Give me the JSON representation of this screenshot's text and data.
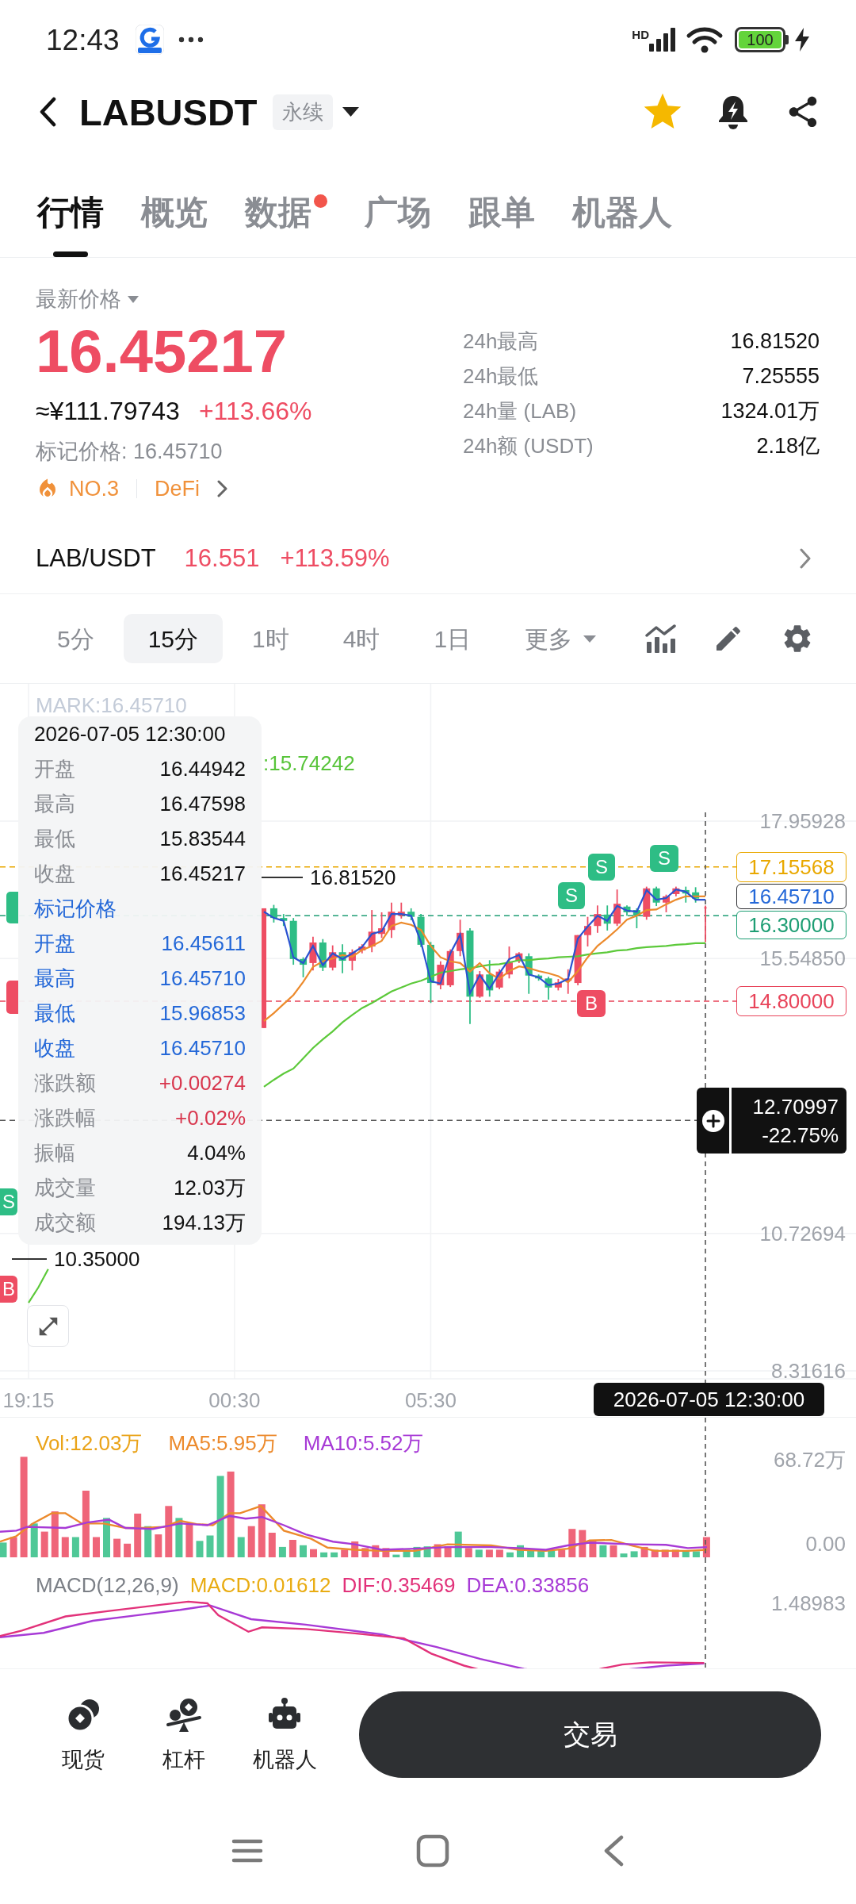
{
  "status_bar": {
    "time": "12:43",
    "network": "HD",
    "battery": "100",
    "charging": true
  },
  "header": {
    "symbol": "LABUSDT",
    "badge": "永续",
    "favorite": true
  },
  "tabs": [
    {
      "label": "行情",
      "selected": true,
      "dot": false
    },
    {
      "label": "概览",
      "selected": false,
      "dot": false
    },
    {
      "label": "数据",
      "selected": false,
      "dot": true
    },
    {
      "label": "广场",
      "selected": false,
      "dot": false
    },
    {
      "label": "跟单",
      "selected": false,
      "dot": false
    },
    {
      "label": "机器人",
      "selected": false,
      "dot": false
    }
  ],
  "price": {
    "label": "最新价格",
    "last": "16.45217",
    "cny": "≈¥111.79743",
    "change": "+113.66%",
    "mark": "标记价格: 16.45710",
    "rank": "NO.3",
    "sector": "DeFi"
  },
  "stats": [
    {
      "label": "24h最高",
      "value": "16.81520"
    },
    {
      "label": "24h最低",
      "value": "7.25555"
    },
    {
      "label": "24h量 (LAB)",
      "value": "1324.01万"
    },
    {
      "label": "24h额 (USDT)",
      "value": "2.18亿"
    }
  ],
  "spot_pair": {
    "pair": "LAB/USDT",
    "price": "16.551",
    "change": "+113.59%"
  },
  "intervals": [
    {
      "label": "5分",
      "kind": "option",
      "selected": false
    },
    {
      "label": "15分",
      "kind": "option",
      "selected": true
    },
    {
      "label": "1时",
      "kind": "option",
      "selected": false
    },
    {
      "label": "4时",
      "kind": "option",
      "selected": false
    },
    {
      "label": "1日",
      "kind": "option",
      "selected": false
    },
    {
      "label": "更多",
      "kind": "menu",
      "selected": false
    }
  ],
  "chart": {
    "mark_legend": "MARK:16.45710",
    "ma_legend": ":15.74242",
    "mark_price_tag": {
      "label": "16.45710",
      "color": "#2468d8"
    },
    "crosshair": {
      "change": "-22.75%",
      "price": "12.70997",
      "time": "2026-07-05 12:30:00"
    },
    "markers": [
      {
        "kind": "sell",
        "label": "S"
      },
      {
        "kind": "buy",
        "label": "B"
      },
      {
        "kind": "sell",
        "label": "S"
      },
      {
        "kind": "sell",
        "label": "S"
      },
      {
        "kind": "sell",
        "label": "S"
      },
      {
        "kind": "buy",
        "label": "B"
      }
    ],
    "chart_data": {
      "type": "candlestick",
      "grid": true,
      "ylim": [
        8.177,
        20.367
      ],
      "yticks": [
        {
          "value": 17.95928,
          "label": "17.95928"
        },
        {
          "value": 15.5485,
          "label": "15.54850"
        },
        {
          "value": 10.72694,
          "label": "10.72694"
        },
        {
          "value": 8.31616,
          "label": "8.31616"
        }
      ],
      "categories": [
        "19:15",
        null,
        null,
        null,
        null,
        null,
        null,
        null,
        null,
        null,
        null,
        null,
        null,
        null,
        null,
        null,
        null,
        null,
        null,
        null,
        null,
        "00:30",
        null,
        null,
        null,
        null,
        null,
        null,
        null,
        null,
        null,
        null,
        null,
        null,
        null,
        null,
        null,
        null,
        null,
        null,
        null,
        "05:30",
        null,
        null,
        null,
        null,
        null,
        null,
        null,
        null,
        null,
        null,
        null,
        null,
        null,
        null,
        null,
        null,
        null,
        null,
        null,
        null,
        null,
        null,
        null,
        null,
        null,
        null,
        null,
        null
      ],
      "ohlc": [
        null,
        null,
        null,
        null,
        null,
        null,
        null,
        null,
        null,
        null,
        null,
        null,
        null,
        null,
        null,
        null,
        null,
        null,
        null,
        null,
        null,
        null,
        null,
        null,
        [
          14.33,
          16.43,
          14.33,
          16.43
        ],
        [
          16.43,
          16.49,
          16.18,
          16.26
        ],
        [
          16.26,
          16.33,
          16.12,
          16.21
        ],
        [
          16.21,
          16.26,
          15.44,
          15.54
        ],
        [
          15.54,
          15.57,
          15.22,
          15.44
        ],
        [
          15.47,
          15.93,
          15.34,
          15.83
        ],
        [
          15.83,
          15.89,
          15.33,
          15.39
        ],
        [
          15.39,
          15.78,
          15.34,
          15.66
        ],
        [
          15.66,
          15.8,
          15.29,
          15.51
        ],
        [
          15.51,
          15.71,
          15.34,
          15.66
        ],
        [
          15.69,
          15.8,
          15.64,
          15.76
        ],
        [
          15.76,
          16.4,
          15.66,
          16.02
        ],
        [
          15.98,
          16.36,
          15.91,
          16.08
        ],
        [
          16.05,
          16.53,
          15.91,
          16.37
        ],
        [
          16.3,
          16.53,
          16.25,
          16.37
        ],
        [
          16.37,
          16.43,
          16.22,
          16.28
        ],
        [
          16.28,
          16.33,
          15.75,
          15.79
        ],
        [
          15.79,
          15.84,
          14.77,
          15.12
        ],
        [
          15.08,
          15.5,
          15.01,
          15.44
        ],
        [
          15.08,
          15.71,
          15.05,
          15.68
        ],
        [
          15.68,
          16.23,
          15.59,
          16.0
        ],
        [
          16.04,
          16.08,
          14.4,
          14.88
        ],
        [
          14.88,
          15.33,
          14.86,
          15.27
        ],
        [
          15.27,
          15.52,
          14.88,
          14.99
        ],
        [
          15.04,
          15.36,
          15.01,
          15.32
        ],
        [
          15.27,
          15.76,
          15.2,
          15.48
        ],
        [
          15.5,
          15.66,
          15.47,
          15.64
        ],
        [
          15.59,
          15.64,
          14.93,
          15.25
        ],
        [
          15.25,
          15.27,
          15.16,
          15.2
        ],
        [
          15.2,
          15.23,
          14.83,
          15.04
        ],
        [
          15.04,
          15.19,
          14.99,
          15.13
        ],
        [
          15.16,
          15.36,
          14.93,
          15.2
        ],
        [
          15.12,
          15.96,
          15.08,
          15.96
        ],
        [
          15.96,
          16.28,
          15.76,
          16.12
        ],
        [
          16.12,
          16.48,
          16.0,
          16.33
        ],
        [
          16.32,
          16.48,
          16.04,
          16.16
        ],
        [
          16.16,
          16.76,
          16.12,
          16.51
        ],
        [
          16.46,
          16.48,
          16.3,
          16.36
        ],
        [
          16.4,
          16.43,
          16.08,
          16.3
        ],
        [
          16.28,
          16.81,
          16.23,
          16.78
        ],
        [
          16.78,
          16.81,
          16.47,
          16.53
        ],
        [
          16.53,
          16.67,
          16.36,
          16.64
        ],
        [
          16.68,
          16.81,
          16.64,
          16.78
        ],
        [
          16.75,
          16.81,
          16.53,
          16.69
        ],
        [
          16.71,
          16.8,
          16.53,
          16.6
        ],
        [
          16.44942,
          16.47598,
          15.83544,
          16.45217
        ]
      ],
      "series": [
        {
          "type": "line",
          "color": "#5cc93a",
          "values": [
            9.51,
            9.78,
            10.1,
            null,
            null,
            null,
            null,
            null,
            null,
            null,
            null,
            null,
            null,
            null,
            null,
            null,
            null,
            null,
            null,
            null,
            null,
            null,
            null,
            null,
            13.3,
            13.42,
            13.53,
            13.62,
            13.8,
            13.98,
            14.13,
            14.27,
            14.43,
            14.56,
            14.68,
            14.77,
            14.87,
            14.97,
            15.04,
            15.11,
            15.16,
            15.23,
            15.3,
            15.33,
            15.36,
            15.38,
            15.41,
            15.44,
            15.45,
            15.48,
            15.52,
            15.52,
            15.54,
            15.55,
            15.57,
            15.58,
            15.59,
            15.62,
            15.64,
            15.66,
            15.69,
            15.7,
            15.73,
            15.75,
            15.76,
            15.77,
            15.79,
            15.8,
            15.82,
            15.82
          ]
        },
        {
          "type": "line",
          "color": "#ec8a2c",
          "values": [
            null,
            null,
            null,
            null,
            null,
            null,
            null,
            null,
            null,
            null,
            null,
            null,
            null,
            null,
            null,
            null,
            null,
            null,
            null,
            null,
            null,
            null,
            null,
            null,
            14.45,
            14.59,
            14.75,
            14.91,
            15.14,
            15.4,
            15.5,
            15.55,
            15.61,
            15.58,
            15.7,
            15.77,
            15.86,
            16.12,
            16.18,
            16.14,
            16.05,
            15.77,
            15.57,
            15.5,
            15.47,
            15.32,
            15.47,
            15.29,
            15.19,
            15.33,
            15.41,
            15.38,
            15.33,
            15.29,
            15.24,
            15.13,
            15.33,
            15.57,
            15.77,
            15.91,
            16.06,
            16.23,
            16.3,
            16.4,
            16.41,
            16.5,
            16.58,
            16.64,
            16.64,
            16.64
          ]
        },
        {
          "type": "line",
          "color": "#2a52d0",
          "values": [
            null,
            null,
            null,
            null,
            null,
            null,
            null,
            null,
            null,
            null,
            null,
            null,
            null,
            null,
            null,
            null,
            null,
            null,
            null,
            null,
            null,
            null,
            null,
            null,
            16.37,
            16.26,
            16.21,
            15.57,
            15.47,
            15.77,
            15.43,
            15.64,
            15.54,
            15.64,
            15.75,
            15.98,
            16.03,
            16.33,
            16.33,
            16.3,
            15.84,
            15.15,
            15.11,
            15.64,
            15.97,
            14.94,
            15.26,
            15.02,
            15.29,
            15.54,
            15.61,
            15.27,
            15.22,
            15.08,
            15.11,
            15.19,
            15.9,
            16.11,
            16.3,
            16.21,
            16.47,
            16.39,
            16.37,
            16.75,
            16.58,
            16.61,
            16.76,
            16.72,
            16.58,
            16.58
          ]
        }
      ],
      "ref_lines": [
        {
          "axis": "y",
          "value": 17.15568,
          "label": "17.15568",
          "color": "#e9a800"
        },
        {
          "axis": "y",
          "value": 16.3,
          "label": "16.30000",
          "color": "#1e9e74"
        },
        {
          "axis": "y",
          "value": 14.8,
          "label": "14.80000",
          "color": "#e8445a"
        },
        {
          "axis": "y",
          "value": 12.70997,
          "color": "#555555"
        }
      ],
      "annotations": [
        "16.81520",
        "10.35000"
      ]
    },
    "tooltip": {
      "time": "2026-07-05 12:30:00",
      "rows": [
        {
          "kind": "price",
          "label": "开盘",
          "value": "16.44942"
        },
        {
          "kind": "price",
          "label": "最高",
          "value": "16.47598"
        },
        {
          "kind": "price",
          "label": "最低",
          "value": "15.83544"
        },
        {
          "kind": "price",
          "label": "收盘",
          "value": "16.45217"
        },
        {
          "kind": "heading",
          "label": "标记价格"
        },
        {
          "kind": "mark",
          "label": "开盘",
          "value": "16.45611"
        },
        {
          "kind": "mark",
          "label": "最高",
          "value": "16.45710"
        },
        {
          "kind": "mark",
          "label": "最低",
          "value": "15.96853"
        },
        {
          "kind": "mark",
          "label": "收盘",
          "value": "16.45710"
        },
        {
          "kind": "change",
          "label": "涨跌额",
          "value": "+0.00274"
        },
        {
          "kind": "change",
          "label": "涨跌幅",
          "value": "+0.02%"
        },
        {
          "kind": "price",
          "label": "振幅",
          "value": "4.04%"
        },
        {
          "kind": "price",
          "label": "成交量",
          "value": "12.03万"
        },
        {
          "kind": "price",
          "label": "成交额",
          "value": "194.13万"
        }
      ]
    }
  },
  "volume": {
    "legend": [
      {
        "text": "Vol:12.03万",
        "color": "#eaa318"
      },
      {
        "text": "MA5:5.95万",
        "color": "#ec8a2c"
      },
      {
        "text": "MA10:5.52万",
        "color": "#a73ad6"
      }
    ],
    "axis": [
      "68.72万",
      "0.00"
    ]
  },
  "macd": {
    "legend": [
      {
        "text": "MACD(12,26,9)",
        "color": "#7b7f86"
      },
      {
        "text": "MACD:0.01612",
        "color": "#e9ac12"
      },
      {
        "text": "DIF:0.35469",
        "color": "#e2327a"
      },
      {
        "text": "DEA:0.33856",
        "color": "#a73ad6"
      }
    ],
    "axis": "1.48983"
  },
  "bottom_nav": [
    {
      "label": "现货",
      "kind": "spot"
    },
    {
      "label": "杠杆",
      "kind": "margin"
    },
    {
      "label": "机器人",
      "kind": "bot"
    }
  ],
  "trade_button": "交易"
}
